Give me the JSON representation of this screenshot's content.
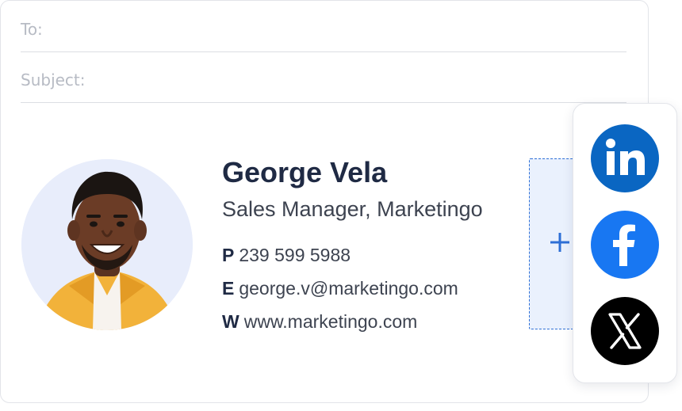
{
  "compose": {
    "to_label": "To:",
    "to_value": "",
    "subject_label": "Subject:",
    "subject_value": ""
  },
  "signature": {
    "name": "George Vela",
    "title": "Sales Manager, Marketingo",
    "phone_prefix": "P",
    "phone": "239 599 5988",
    "email_prefix": "E",
    "email": "george.v@marketingo.com",
    "web_prefix": "W",
    "website": "www.marketingo.com"
  },
  "add_zone": {
    "icon": "plus-icon"
  },
  "social": {
    "items": [
      {
        "icon": "linkedin-icon",
        "color": "#0a66c2"
      },
      {
        "icon": "facebook-icon",
        "color": "#1877f2"
      },
      {
        "icon": "x-icon",
        "color": "#000000"
      }
    ]
  },
  "colors": {
    "name": "#1f2a44",
    "text": "#3d4350",
    "accent": "#2d6fd6",
    "avatar_bg": "#e8edfb"
  }
}
